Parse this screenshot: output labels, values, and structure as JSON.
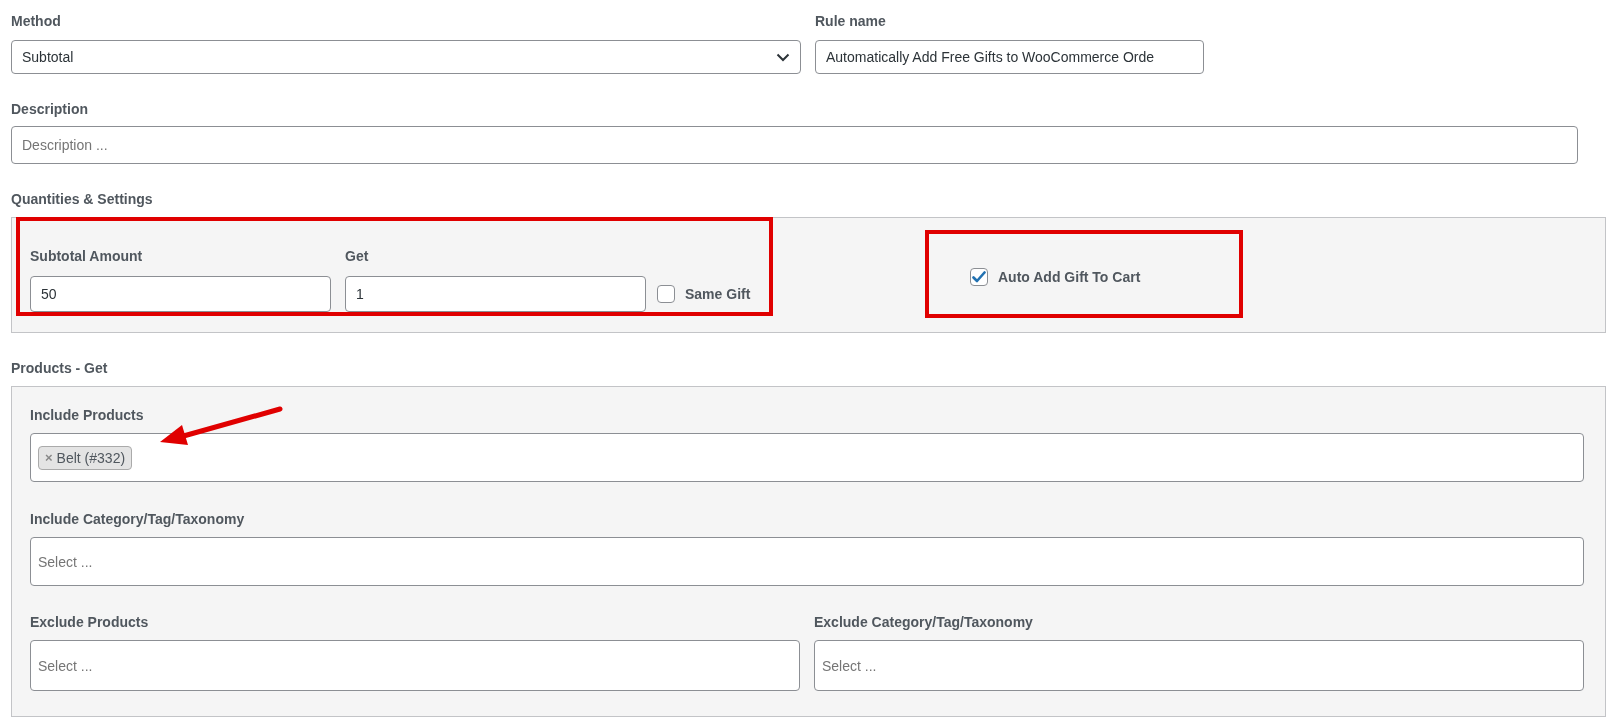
{
  "method": {
    "label": "Method",
    "value": "Subtotal"
  },
  "rule_name": {
    "label": "Rule name",
    "value": "Automatically Add Free Gifts to WooCommerce Orde"
  },
  "description": {
    "label": "Description",
    "placeholder": "Description ..."
  },
  "quantities": {
    "title": "Quantities & Settings",
    "subtotal_amount": {
      "label": "Subtotal Amount",
      "value": "50"
    },
    "get": {
      "label": "Get",
      "value": "1"
    },
    "same_gift": {
      "label": "Same Gift",
      "checked": false
    },
    "auto_add": {
      "label": "Auto Add Gift To Cart",
      "checked": true
    }
  },
  "products_get": {
    "title": "Products - Get",
    "include_products": {
      "label": "Include Products",
      "tags": [
        {
          "label": "Belt (#332)",
          "remove": "×"
        }
      ]
    },
    "include_category": {
      "label": "Include Category/Tag/Taxonomy",
      "placeholder": "Select ..."
    },
    "exclude_products": {
      "label": "Exclude Products",
      "placeholder": "Select ..."
    },
    "exclude_category": {
      "label": "Exclude Category/Tag/Taxonomy",
      "placeholder": "Select ..."
    }
  }
}
